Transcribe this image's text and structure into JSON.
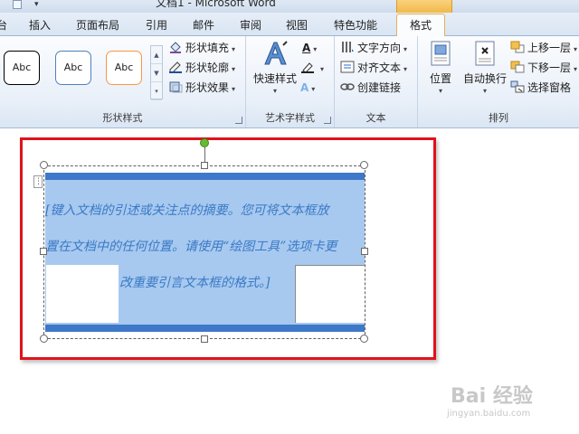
{
  "window": {
    "title": "文档1 - Microsoft Word"
  },
  "tabs": {
    "items": [
      "插入",
      "页面布局",
      "引用",
      "邮件",
      "审阅",
      "视图",
      "特色功能"
    ],
    "active": "格式",
    "partial_left": "台"
  },
  "ribbon": {
    "shape_styles": {
      "label": "形状样式",
      "gallery": [
        "Abc",
        "Abc",
        "Abc"
      ],
      "gallery_colors": [
        "#000000",
        "#4f81bd",
        "#f79646"
      ],
      "fill": "形状填充",
      "outline": "形状轮廓",
      "effect": "形状效果"
    },
    "art_text": {
      "label": "艺术字样式",
      "quick_styles": "快速样式",
      "text_glyph": "A"
    },
    "text": {
      "label": "文本",
      "direction": "文字方向",
      "align": "对齐文本",
      "link": "创建链接"
    },
    "arrange": {
      "label": "排列",
      "position": "位置",
      "wrap": "自动换行",
      "bring_forward": "上移一层",
      "send_backward": "下移一层",
      "selection_pane": "选择窗格"
    }
  },
  "document": {
    "quote_lines": [
      "[键入文档的引述或关注点的摘要。您可将文本框放",
      "置在文档中的任何位置。请使用“绘图工具”选项卡更",
      "改重要引言文本框的格式。]"
    ],
    "accent_color": "#3e78c8",
    "fill_color": "#a7c9ef",
    "highlight_color": "#e0121b"
  },
  "watermark": {
    "brand": "Bai 经验",
    "url": "jingyan.baidu.com"
  }
}
